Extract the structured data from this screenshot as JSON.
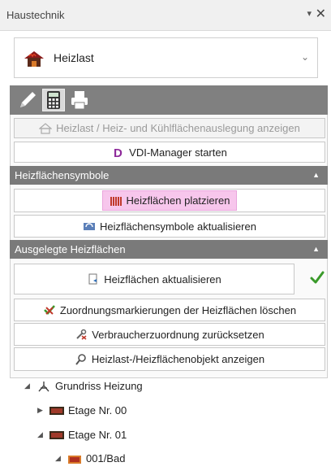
{
  "window": {
    "title": "Haustechnik",
    "pin_glyph": "▾",
    "close_glyph": "✕"
  },
  "dropdown": {
    "label": "Heizlast",
    "icon": "house-heat-icon",
    "chevron": "⌄"
  },
  "toolbar": {
    "tools": [
      "pencil-icon",
      "calculator-icon",
      "printer-icon"
    ],
    "active_tool": "calculator-icon"
  },
  "buttons": {
    "show_heat_load": "Heizlast / Heiz- und Kühlflächenauslegung anzeigen",
    "vdi_manager": "VDI-Manager starten"
  },
  "sections": {
    "symbols": {
      "title": "Heizflächensymbole",
      "arrow": "▲"
    },
    "designed": {
      "title": "Ausgelegte Heizflächen",
      "arrow": "▲"
    }
  },
  "symbol_buttons": {
    "place": "Heizflächen platzieren",
    "update_symbols": "Heizflächensymbole aktualisieren"
  },
  "designed_buttons": {
    "update": "Heizflächen aktualisieren",
    "delete_markers": "Zuordnungsmarkierungen der Heizflächen löschen",
    "reset_assignment": "Verbraucherzuordnung zurücksetzen",
    "show_object": "Heizlast-/Heizflächenobjekt anzeigen"
  },
  "tree": [
    {
      "label": "Grundriss Heizung",
      "expander": "◢",
      "icon": "floorplan-icon"
    },
    {
      "label": "Etage Nr. 00",
      "expander": "▶",
      "icon": "floor-icon"
    },
    {
      "label": "Etage Nr. 01",
      "expander": "◢",
      "icon": "floor-icon"
    },
    {
      "label": "001/Bad",
      "expander": "◢",
      "icon": "room-icon"
    }
  ],
  "colors": {
    "section_bg": "#7a7a7a",
    "toolbar_bg": "#808080",
    "highlight": "#f7c6ec",
    "check": "#3a9a2a"
  }
}
